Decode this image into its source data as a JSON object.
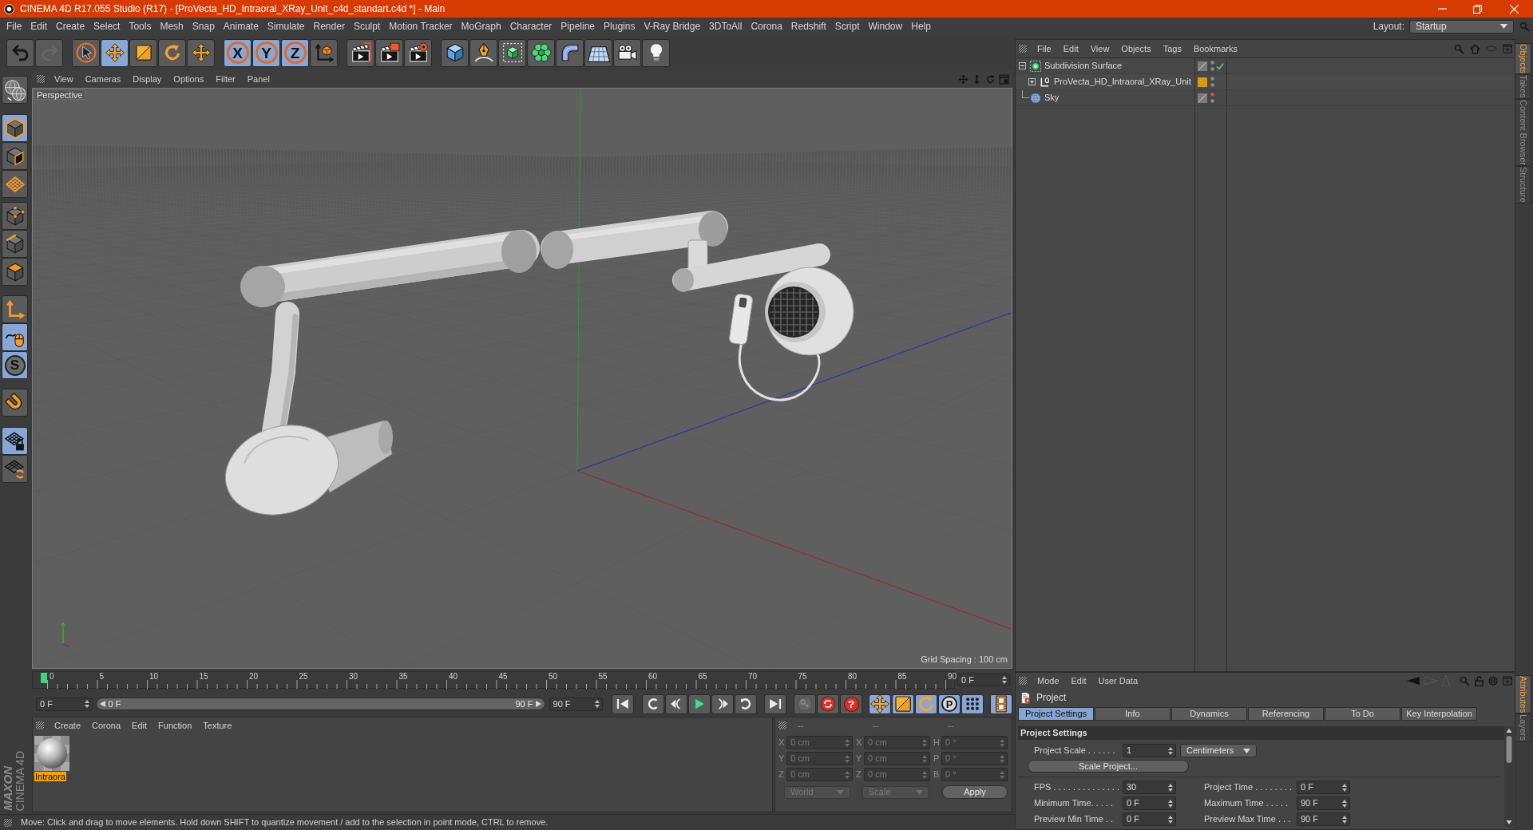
{
  "window": {
    "title": "CINEMA 4D R17.055 Studio (R17) - [ProVecta_HD_Intraoral_XRay_Unit_c4d_standart.c4d *] - Main"
  },
  "menu_bar": [
    "File",
    "Edit",
    "Create",
    "Select",
    "Tools",
    "Mesh",
    "Snap",
    "Animate",
    "Simulate",
    "Render",
    "Sculpt",
    "Motion Tracker",
    "MoGraph",
    "Character",
    "Pipeline",
    "Plugins",
    "V-Ray Bridge",
    "3DToAll",
    "Corona",
    "Redshift",
    "Script",
    "Window",
    "Help"
  ],
  "layout": {
    "label": "Layout:",
    "value": "Startup"
  },
  "toolbar": [
    {
      "buttons": [
        {
          "active": false,
          "disabled": false
        },
        {
          "active": false,
          "disabled": true
        }
      ]
    },
    {
      "buttons": [
        {
          "active": false,
          "disabled": false
        },
        {
          "active": true,
          "disabled": false
        },
        {
          "active": false,
          "disabled": false
        },
        {
          "active": false,
          "disabled": false
        },
        {
          "active": false,
          "disabled": false
        }
      ]
    },
    {
      "buttons": [
        {
          "glyph": "X",
          "active": true,
          "disabled": false
        },
        {
          "glyph": "Y",
          "active": true,
          "disabled": false
        },
        {
          "glyph": "Z",
          "active": true,
          "disabled": false
        },
        {
          "active": false,
          "disabled": false
        }
      ]
    },
    {
      "buttons": [
        {
          "active": false,
          "disabled": false
        },
        {
          "active": false,
          "disabled": false
        },
        {
          "active": false,
          "disabled": false
        }
      ]
    },
    {
      "buttons": [
        {
          "active": false,
          "disabled": false
        },
        {
          "active": false,
          "disabled": false
        },
        {
          "active": false,
          "disabled": false
        },
        {
          "active": false,
          "disabled": false
        },
        {
          "active": false,
          "disabled": false
        },
        {
          "active": false,
          "disabled": false
        },
        {
          "active": false,
          "disabled": false
        },
        {
          "active": false,
          "disabled": false
        }
      ]
    }
  ],
  "tool_strip": [
    {
      "buttons": [
        {
          "active": false
        }
      ]
    },
    {
      "buttons": [
        {
          "active": true
        },
        {
          "active": false
        },
        {
          "active": false
        }
      ]
    },
    {
      "buttons": [
        {
          "active": false
        },
        {
          "active": false
        },
        {
          "active": false
        }
      ]
    },
    {
      "buttons": [
        {
          "active": false
        },
        {
          "active": true
        },
        {
          "glyph": "S",
          "active": true
        }
      ]
    },
    {
      "buttons": [
        {
          "active": false
        }
      ]
    },
    {
      "buttons": [
        {
          "active": true
        },
        {
          "active": false
        }
      ]
    }
  ],
  "logo": {
    "brand": "MAXON",
    "product": "CINEMA 4D"
  },
  "viewport": {
    "menu": [
      "View",
      "Cameras",
      "Display",
      "Options",
      "Filter",
      "Panel"
    ],
    "camera": "Perspective",
    "grid_spacing": "Grid Spacing : 100 cm"
  },
  "timeline": {
    "ticks": [
      "0",
      "5",
      "10",
      "15",
      "20",
      "25",
      "30",
      "35",
      "40",
      "45",
      "50",
      "55",
      "60",
      "65",
      "70",
      "75",
      "80",
      "85",
      "90"
    ],
    "level": 0,
    "current_frame": "0 F"
  },
  "transport": {
    "start": "0 F",
    "range": {
      "start": "0 F",
      "end": "90 F",
      "level": 1
    },
    "end": "90 F",
    "groups": [
      {
        "buttons": [
          {
            "active": false,
            "disabled": false
          }
        ]
      },
      {
        "buttons": [
          {
            "active": false,
            "disabled": false
          },
          {
            "active": false,
            "disabled": false
          },
          {
            "active": false,
            "disabled": false
          },
          {
            "active": false,
            "disabled": false
          },
          {
            "active": false,
            "disabled": false
          }
        ]
      },
      {
        "buttons": [
          {
            "active": false,
            "disabled": false
          }
        ]
      },
      {
        "buttons": [
          {
            "active": false,
            "disabled": true
          },
          {
            "active": false,
            "disabled": false
          },
          {
            "glyph": "?",
            "active": false,
            "disabled": false
          }
        ]
      },
      {
        "buttons": [
          {
            "active": true,
            "disabled": false
          },
          {
            "active": true,
            "disabled": false
          },
          {
            "active": true,
            "disabled": false
          },
          {
            "glyph": "P",
            "active": true,
            "disabled": false
          },
          {
            "active": true,
            "disabled": false
          }
        ]
      },
      {
        "buttons": [
          {
            "active": true,
            "disabled": false
          }
        ]
      }
    ]
  },
  "materials": {
    "menu": [
      "Create",
      "Corona",
      "Edit",
      "Function",
      "Texture"
    ],
    "items": [
      {
        "name": "Intraora",
        "selected": true
      }
    ]
  },
  "coordinates": {
    "disabled": true,
    "headers": [
      "--",
      "--",
      "--"
    ],
    "rows": [
      [
        {
          "label": "X",
          "value": "0 cm"
        },
        {
          "label": "X",
          "value": "0 cm"
        },
        {
          "label": "H",
          "value": "0 °"
        }
      ],
      [
        {
          "label": "Y",
          "value": "0 cm"
        },
        {
          "label": "Y",
          "value": "0 cm"
        },
        {
          "label": "P",
          "value": "0 °"
        }
      ],
      [
        {
          "label": "Z",
          "value": "0 cm"
        },
        {
          "label": "Z",
          "value": "0 cm"
        },
        {
          "label": "B",
          "value": "0 °"
        }
      ]
    ],
    "mode": "World",
    "transform": "Scale",
    "apply": "Apply"
  },
  "status_bar": {
    "text": "Move: Click and drag to move elements. Hold down SHIFT to quantize movement / add to the selection in point mode, CTRL to remove."
  },
  "objects_panel": {
    "menu": [
      "File",
      "Edit",
      "View",
      "Objects",
      "Tags",
      "Bookmarks"
    ],
    "objects": [
      {
        "name": "Subdivision Surface",
        "kind": "subdivision",
        "expanded": true,
        "editor_hidden": false,
        "render_hidden": false,
        "enabled": true,
        "children": [
          {
            "name": "ProVecta_HD_Intraoral_XRay_Unit",
            "kind": "null",
            "expanded": false,
            "color": "#d49b12",
            "editor_hidden": false,
            "render_hidden": false
          }
        ]
      },
      {
        "name": "Sky",
        "kind": "sky",
        "editor_hidden": true,
        "render_hidden": false
      }
    ]
  },
  "attributes": {
    "menu": [
      "Mode",
      "Edit",
      "User Data"
    ],
    "title": "Project",
    "tabs": [
      {
        "label": "Project Settings",
        "selected": true
      },
      {
        "label": "Info",
        "selected": false
      },
      {
        "label": "Dynamics",
        "selected": false
      },
      {
        "label": "Referencing",
        "selected": false
      },
      {
        "label": "To Do",
        "selected": false
      },
      {
        "label": "Key Interpolation",
        "selected": false
      }
    ],
    "section": "Project Settings",
    "project_scale": {
      "label": "Project Scale . . . . . .",
      "value": "1",
      "unit": "Centimeters"
    },
    "scale_button": "Scale Project...",
    "fields": [
      {
        "label": "FPS . . . . . . . . . . . . . .",
        "value": "30"
      },
      {
        "label": "Project Time . . . . . . . .",
        "value": "0 F"
      },
      {
        "label": "Minimum Time. . . . .",
        "value": "0 F"
      },
      {
        "label": "Maximum Time . . . . .",
        "value": "90 F"
      },
      {
        "label": "Preview Min Time . .",
        "value": "0 F"
      },
      {
        "label": "Preview Max Time . . .",
        "value": "90 F"
      }
    ]
  },
  "side_tabs": {
    "top": [
      {
        "label": "Objects",
        "selected": true
      },
      {
        "label": "Takes",
        "selected": false
      },
      {
        "label": "Content Browser",
        "selected": false
      },
      {
        "label": "Structure",
        "selected": false
      }
    ],
    "bottom": [
      {
        "label": "Attributes",
        "selected": true
      },
      {
        "label": "Layers",
        "selected": false
      }
    ]
  }
}
